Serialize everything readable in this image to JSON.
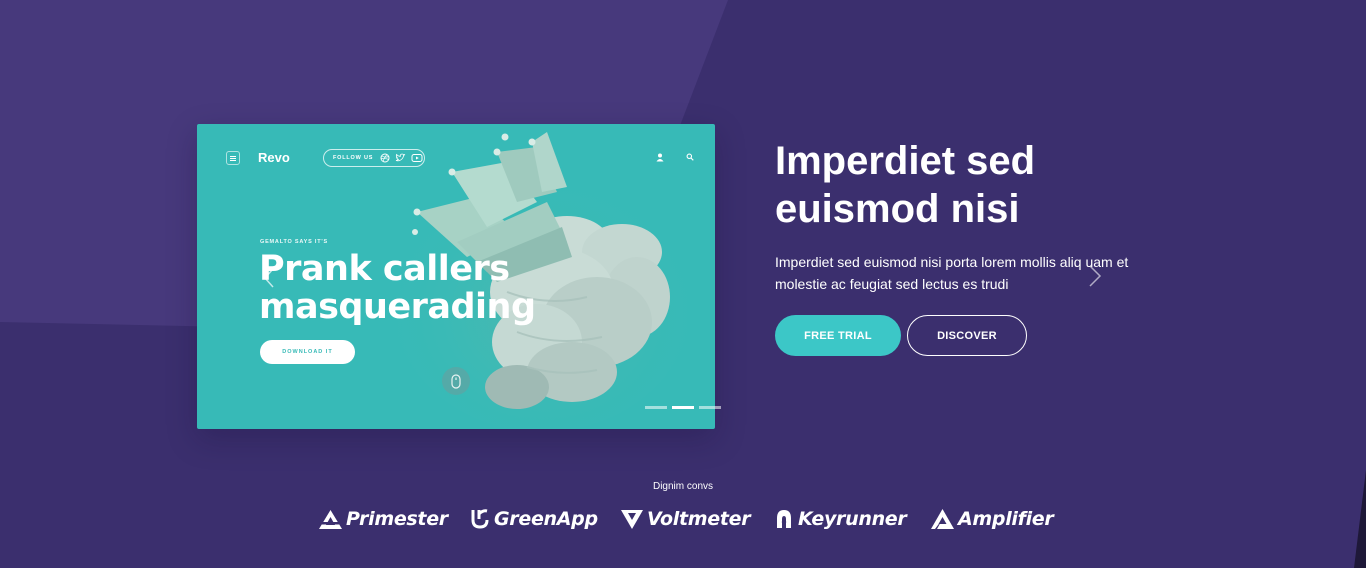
{
  "colors": {
    "background": "#3b2f6e",
    "background_light": "#47397c",
    "mockup": "#37bab7",
    "accent": "#3cc7c7",
    "text": "#ffffff"
  },
  "mockup": {
    "brand": "Revo",
    "follow_label": "FOLLOW US",
    "kicker": "GEMALTO SAYS IT'S",
    "headline": "Prank callers masquerading",
    "download_label": "DOWNLOAD IT",
    "icons": [
      "menu-icon",
      "dribbble-icon",
      "twitter-icon",
      "youtube-icon",
      "user-icon",
      "search-icon",
      "mouse-scroll-icon",
      "chevron-left-icon"
    ]
  },
  "slider": {
    "dots": 3,
    "active_dot": 2
  },
  "hero": {
    "title": "Imperdiet sed euismod nisi",
    "description": "Imperdiet sed euismod nisi porta lorem mollis aliq uam et molestie ac feugiat sed lectus es trudi",
    "primary_button": "FREE TRIAL",
    "secondary_button": "DISCOVER",
    "next_icon": "chevron-right-icon"
  },
  "clients": {
    "caption": "Dignim convs",
    "logos": [
      {
        "name": "Primester",
        "icon": "primester-logo-icon"
      },
      {
        "name": "GreenApp",
        "icon": "greenapp-logo-icon"
      },
      {
        "name": "Voltmeter",
        "icon": "voltmeter-logo-icon"
      },
      {
        "name": "Keyrunner",
        "icon": "keyrunner-logo-icon"
      },
      {
        "name": "Amplifier",
        "icon": "amplifier-logo-icon"
      }
    ]
  }
}
